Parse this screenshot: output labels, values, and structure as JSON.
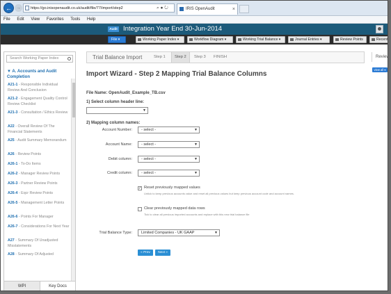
{
  "browser": {
    "url": "https://go.inisopenaudit.co.uk/audit/file/77/import/step2",
    "tab_title": "IRIS OpenAudit",
    "menu": [
      "File",
      "Edit",
      "View",
      "Favorites",
      "Tools",
      "Help"
    ]
  },
  "app": {
    "logo_text": "Audit",
    "title": "Integration Year End 30-Jun-2014"
  },
  "toolbar": {
    "file": "File",
    "items": [
      "Working Paper Index",
      "Workflow Diagram",
      "Working Trial Balance",
      "Journal Entries",
      "Review Points",
      "Recent"
    ]
  },
  "sidebar": {
    "search_placeholder": "Search Working Paper Index",
    "section_title": "A. Accounts and Audit Completion",
    "items": [
      {
        "code": "A21-1",
        "label": "- Responsible Individual Review And Conclusion"
      },
      {
        "code": "A21-2",
        "label": "- Engagement Quality Control Review Checklist"
      },
      {
        "code": "A21-3",
        "label": "- Consultation / Ethics Review"
      },
      {
        "code": "A22",
        "label": "- Overall Review Of The Financial Statements"
      },
      {
        "code": "A25",
        "label": "- Audit Summary Memorandum"
      },
      {
        "code": "A26",
        "label": "- Review Points"
      },
      {
        "code": "A26-1",
        "label": "- To-Do Items"
      },
      {
        "code": "A26-2",
        "label": "- Manager Review Points"
      },
      {
        "code": "A26-3",
        "label": "- Partner Review Points"
      },
      {
        "code": "A26-4",
        "label": "- Eqcr Review Points"
      },
      {
        "code": "A26-5",
        "label": "- Management Letter Points"
      },
      {
        "code": "A26-6",
        "label": "- Points For Manager"
      },
      {
        "code": "A26-7",
        "label": "- Considerations For Next Year"
      },
      {
        "code": "A27",
        "label": "- Summary Of Unadjusted Misstatements"
      },
      {
        "code": "A28",
        "label": "- Summary Of Adjusted"
      }
    ],
    "tabs": {
      "wpi": "WPI",
      "key_docs": "Key Docs"
    }
  },
  "wizard": {
    "header": "Trial Balance Import",
    "steps": [
      "Step 1",
      "Step 2",
      "Step 3",
      "FINISH"
    ],
    "active_step": "Step 2",
    "review_tab": "Review",
    "view_all": "view all"
  },
  "main": {
    "title": "Import Wizard - Step 2 Mapping Trial Balance Columns",
    "file_name": "File Name: OpenAudit_Example_TB.csv",
    "step1_label": "1) Select column header line:",
    "step2_label": "2) Mapping column names:",
    "mappings": [
      {
        "label": "Account Number:",
        "value": "- select -"
      },
      {
        "label": "Account Name:",
        "value": "- select -"
      },
      {
        "label": "Debit column:",
        "value": "- select -"
      },
      {
        "label": "Credit column:",
        "value": "- select -"
      }
    ],
    "reset": {
      "checked": true,
      "label": "Reset previously mapped values",
      "help": "Untick to keep previous accounts value and reset all previous values but keep previous account code and account names."
    },
    "clear": {
      "checked": false,
      "label": "Clear previously mapped data rows",
      "help": "Tick to clear all previous imported accounts and replace with this new trial balance file"
    },
    "tb_type_label": "Trial Balance Type:",
    "tb_type_value": "Limited Companies - UK GAAP",
    "prev": "« Prev",
    "next": "Next »"
  }
}
